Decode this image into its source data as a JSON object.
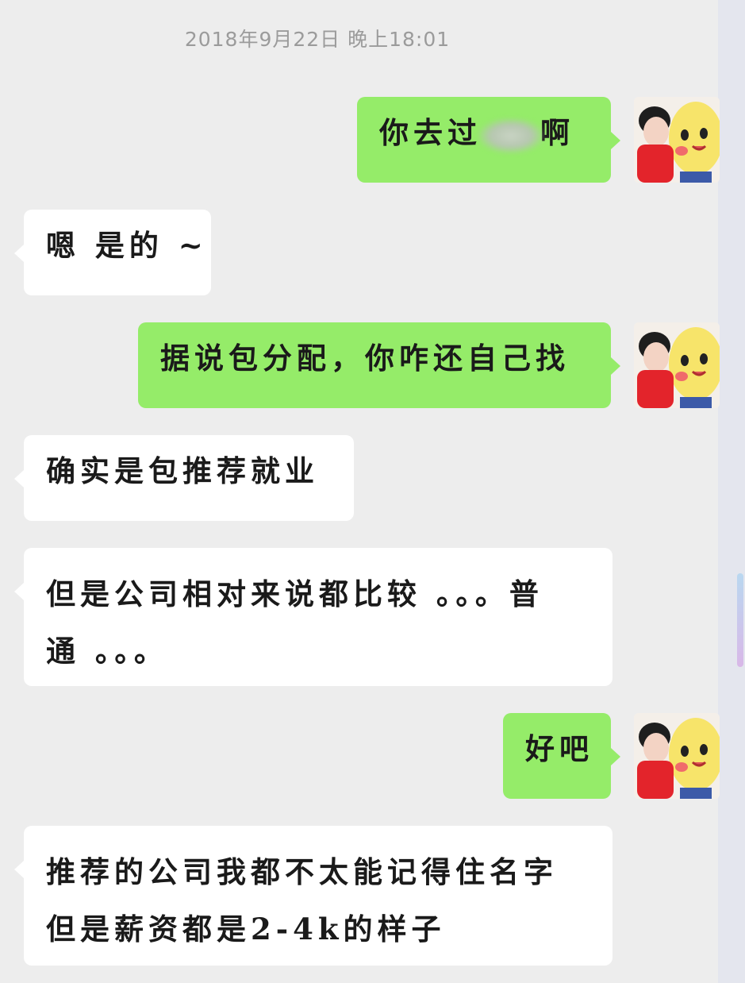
{
  "chat": {
    "timestamp": "2018年9月22日 晚上18:01",
    "messages": [
      {
        "side": "out",
        "text_before": "你去过",
        "text_after": "啊",
        "redacted": true
      },
      {
        "side": "in",
        "text": "嗯 是的 ~"
      },
      {
        "side": "out",
        "text": "据说包分配，你咋还自己找"
      },
      {
        "side": "in",
        "text": "确实是包推荐就业"
      },
      {
        "side": "in",
        "line1": "但是公司相对来说都比较 。。。普",
        "line2": "通 。。。"
      },
      {
        "side": "out",
        "text": "好吧"
      },
      {
        "side": "in",
        "line1": "推荐的公司我都不太能记得住名字",
        "line2": "但是薪资都是2-4k的样子"
      }
    ]
  },
  "colors": {
    "background": "#ededed",
    "incoming_bubble": "#ffffff",
    "outgoing_bubble": "#95ec69",
    "timestamp_text": "#9b9b9b"
  },
  "icons": {
    "avatar": "user-avatar-girl-with-pikachu"
  }
}
